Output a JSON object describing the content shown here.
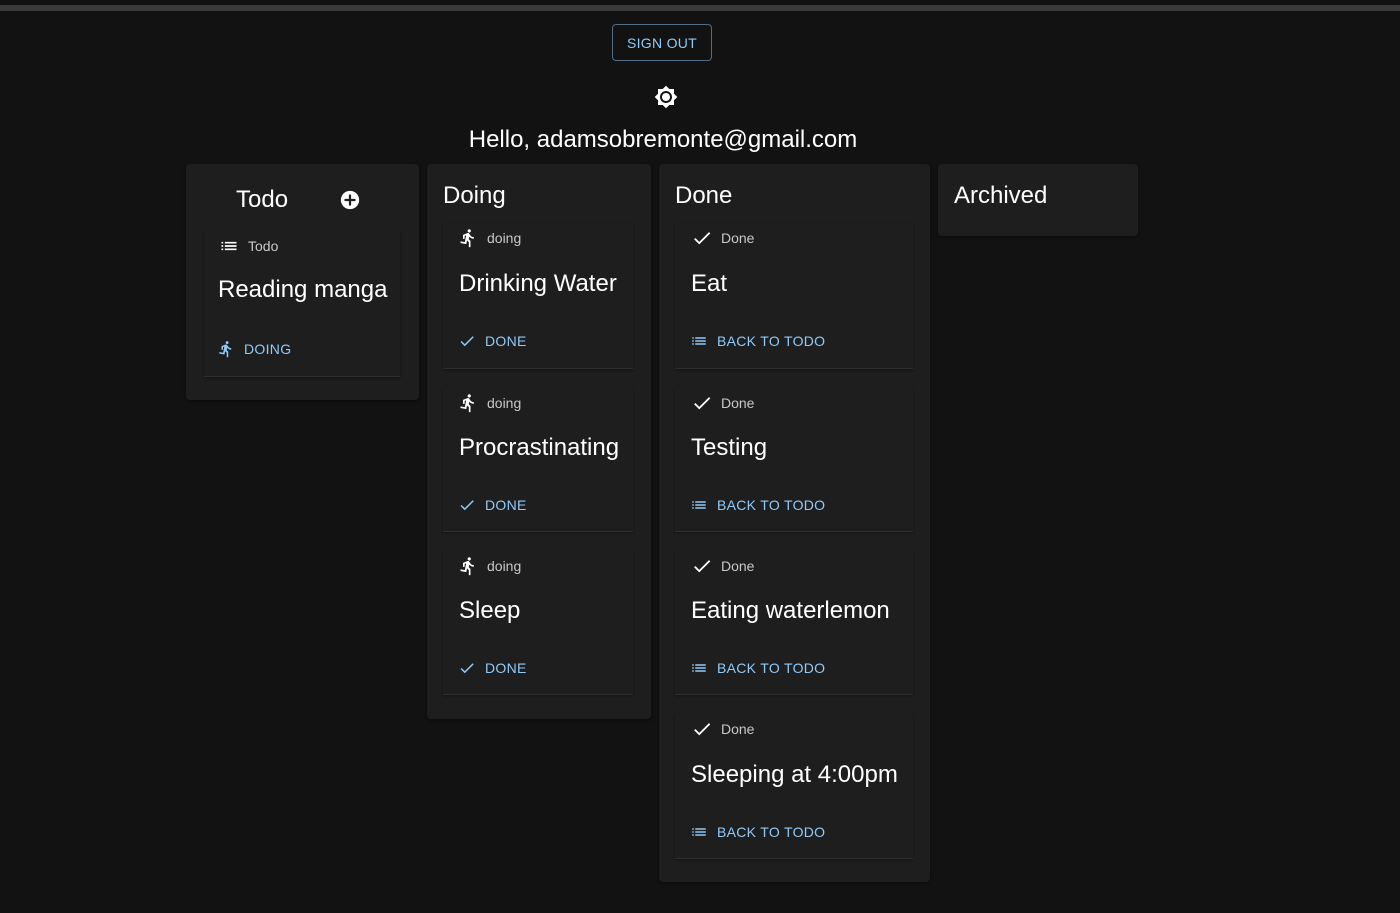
{
  "header": {
    "sign_out_label": "SIGN OUT",
    "greeting": "Hello, adamsobremonte@gmail.com"
  },
  "colors": {
    "background": "#121212",
    "surface": "#1e1e1e",
    "accent": "#90caf9",
    "text": "#ffffff",
    "muted_text": "#c8c8c8"
  },
  "columns": {
    "todo": {
      "title": "Todo",
      "cards": [
        {
          "status": "Todo",
          "title": "Reading manga",
          "action": "DOING",
          "status_icon": "list-icon",
          "action_icon": "running-icon"
        }
      ]
    },
    "doing": {
      "title": "Doing",
      "cards": [
        {
          "status": "doing",
          "title": "Drinking Water",
          "action": "DONE",
          "status_icon": "running-icon",
          "action_icon": "check-icon"
        },
        {
          "status": "doing",
          "title": "Procrastinating",
          "action": "DONE",
          "status_icon": "running-icon",
          "action_icon": "check-icon"
        },
        {
          "status": "doing",
          "title": "Sleep",
          "action": "DONE",
          "status_icon": "running-icon",
          "action_icon": "check-icon"
        }
      ]
    },
    "done": {
      "title": "Done",
      "cards": [
        {
          "status": "Done",
          "title": "Eat",
          "action": "BACK TO TODO",
          "status_icon": "check-icon",
          "action_icon": "list-icon"
        },
        {
          "status": "Done",
          "title": "Testing",
          "action": "BACK TO TODO",
          "status_icon": "check-icon",
          "action_icon": "list-icon"
        },
        {
          "status": "Done",
          "title": "Eating waterlemon",
          "action": "BACK TO TODO",
          "status_icon": "check-icon",
          "action_icon": "list-icon"
        },
        {
          "status": "Done",
          "title": "Sleeping at 4:00pm",
          "action": "BACK TO TODO",
          "status_icon": "check-icon",
          "action_icon": "list-icon"
        }
      ]
    },
    "archived": {
      "title": "Archived",
      "cards": []
    }
  }
}
